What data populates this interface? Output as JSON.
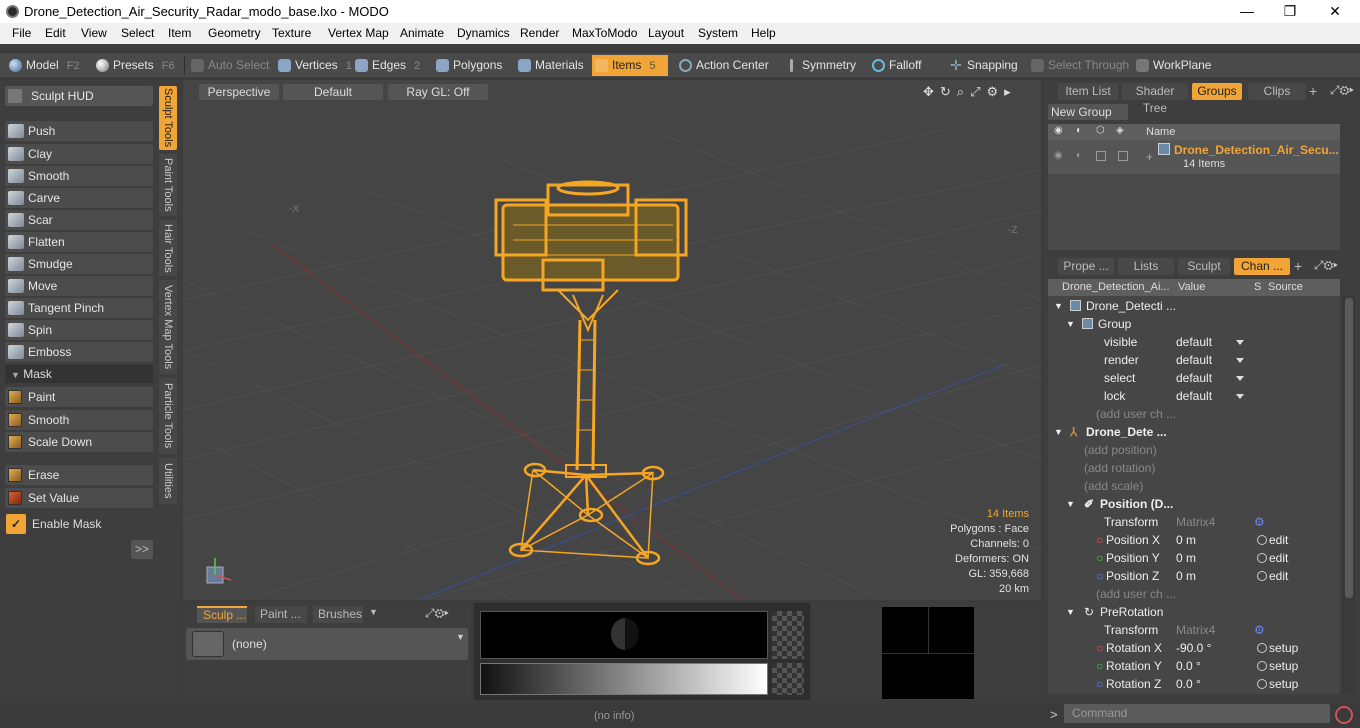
{
  "window": {
    "title": "Drone_Detection_Air_Security_Radar_modo_base.lxo - MODO",
    "minimize": "—",
    "maximize": "❐",
    "close": "✕"
  },
  "menu": [
    "File",
    "Edit",
    "View",
    "Select",
    "Item",
    "Geometry",
    "Texture",
    "Vertex Map",
    "Animate",
    "Dynamics",
    "Render",
    "MaxToModo",
    "Layout",
    "System",
    "Help"
  ],
  "toolbar": {
    "model": "Model",
    "model_key": "F2",
    "presets": "Presets",
    "presets_key": "F6",
    "auto_select": "Auto Select",
    "vertices": "Vertices",
    "vertices_key": "1",
    "edges": "Edges",
    "edges_key": "2",
    "polygons": "Polygons",
    "materials": "Materials",
    "items": "Items",
    "items_key": "5",
    "action_center": "Action Center",
    "symmetry": "Symmetry",
    "falloff": "Falloff",
    "snapping": "Snapping",
    "select_through": "Select Through",
    "workplane": "WorkPlane"
  },
  "left": {
    "sculpt_hud": "Sculpt HUD",
    "tools": [
      "Push",
      "Clay",
      "Smooth",
      "Carve",
      "Scar",
      "Flatten",
      "Smudge",
      "Move",
      "Tangent Pinch",
      "Spin",
      "Emboss"
    ],
    "mask_label": "Mask",
    "mask_tools": [
      "Paint",
      "Smooth",
      "Scale Down"
    ],
    "erase": "Erase",
    "set_value": "Set Value",
    "enable_mask": "Enable Mask",
    "expand": ">>",
    "vtabs": [
      "Sculpt Tools",
      "Paint Tools",
      "Hair Tools",
      "Vertex Map Tools",
      "Particle Tools",
      "Utilities"
    ]
  },
  "viewport": {
    "view": "Perspective",
    "shading": "Default",
    "raygl": "Ray GL: Off",
    "axis_neg_x": "-X",
    "axis_neg_z": "-Z",
    "stats": {
      "items": "14 Items",
      "polygons": "Polygons : Face",
      "channels": "Channels: 0",
      "deformers": "Deformers: ON",
      "gl": "GL: 359,668",
      "distance": "20 km"
    }
  },
  "bottom_left": {
    "tab_sculpt": "Sculp ...",
    "tab_paint": "Paint ...",
    "tab_brushes": "Brushes",
    "none": "(none)"
  },
  "status": "(no info)",
  "command_placeholder": "Command",
  "right_top": {
    "tabs": [
      "Item List",
      "Shader Tree",
      "Groups",
      "Clips"
    ],
    "new_group": "New Group",
    "name_col": "Name",
    "group_name": "Drone_Detection_Air_Secu...",
    "group_count": "14 Items"
  },
  "right_bottom": {
    "tabs": [
      "Prope ...",
      "Lists",
      "Sculpt",
      "Chan ..."
    ],
    "headers": {
      "name": "Drone_Detection_Ai...",
      "value": "Value",
      "s": "S",
      "source": "Source"
    },
    "rows": [
      {
        "label": "Drone_Detecti ...",
        "value": "",
        "source": ""
      },
      {
        "label": "Group",
        "value": "",
        "source": ""
      },
      {
        "label": "visible",
        "value": "default",
        "source": ""
      },
      {
        "label": "render",
        "value": "default",
        "source": ""
      },
      {
        "label": "select",
        "value": "default",
        "source": ""
      },
      {
        "label": "lock",
        "value": "default",
        "source": ""
      },
      {
        "label": "(add user ch ...",
        "value": "",
        "source": ""
      },
      {
        "label": "Drone_Dete ...",
        "value": "",
        "source": ""
      },
      {
        "label": "(add position)",
        "value": "",
        "source": ""
      },
      {
        "label": "(add rotation)",
        "value": "",
        "source": ""
      },
      {
        "label": "(add scale)",
        "value": "",
        "source": ""
      },
      {
        "label": "Position (D...",
        "value": "",
        "source": ""
      },
      {
        "label": "Transform",
        "value": "Matrix4",
        "source": ""
      },
      {
        "label": "Position X",
        "value": "0 m",
        "source": "edit"
      },
      {
        "label": "Position Y",
        "value": "0 m",
        "source": "edit"
      },
      {
        "label": "Position Z",
        "value": "0 m",
        "source": "edit"
      },
      {
        "label": "(add user ch ...",
        "value": "",
        "source": ""
      },
      {
        "label": "PreRotation",
        "value": "",
        "source": ""
      },
      {
        "label": "Transform",
        "value": "Matrix4",
        "source": ""
      },
      {
        "label": "Rotation X",
        "value": "-90.0 °",
        "source": "setup"
      },
      {
        "label": "Rotation Y",
        "value": "0.0 °",
        "source": "setup"
      },
      {
        "label": "Rotation Z",
        "value": "0.0 °",
        "source": "setup"
      }
    ]
  },
  "colors": {
    "accent": "#f1a537",
    "wire": "#f5a623",
    "red_axis": "#8b3030",
    "blue_axis": "#3a4f9a"
  }
}
